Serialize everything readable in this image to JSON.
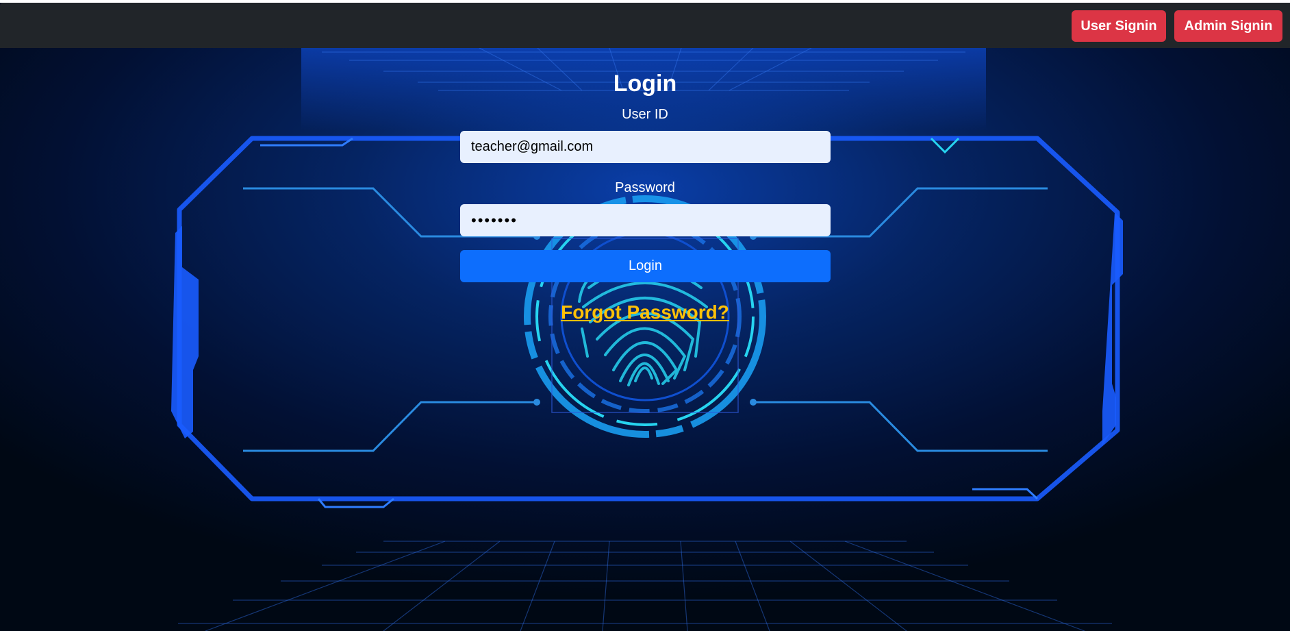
{
  "navbar": {
    "user_signin_label": "User Signin",
    "admin_signin_label": "Admin Signin"
  },
  "login": {
    "title": "Login",
    "user_id_label": "User ID",
    "user_id_value": "teacher@gmail.com",
    "password_label": "Password",
    "password_value": "•••••••",
    "submit_label": "Login",
    "forgot_label": "Forgot Password?"
  },
  "colors": {
    "navbar_bg": "#212529",
    "signin_button": "#dc3545",
    "login_button": "#0d6efd",
    "input_bg": "#e8f0fe",
    "forgot_link": "#ffc107",
    "background": "#000814",
    "glow_cyan": "#27d4f0",
    "frame_blue": "#1a5cff"
  },
  "icons": {
    "background_art": "fingerprint-scanner-icon"
  }
}
